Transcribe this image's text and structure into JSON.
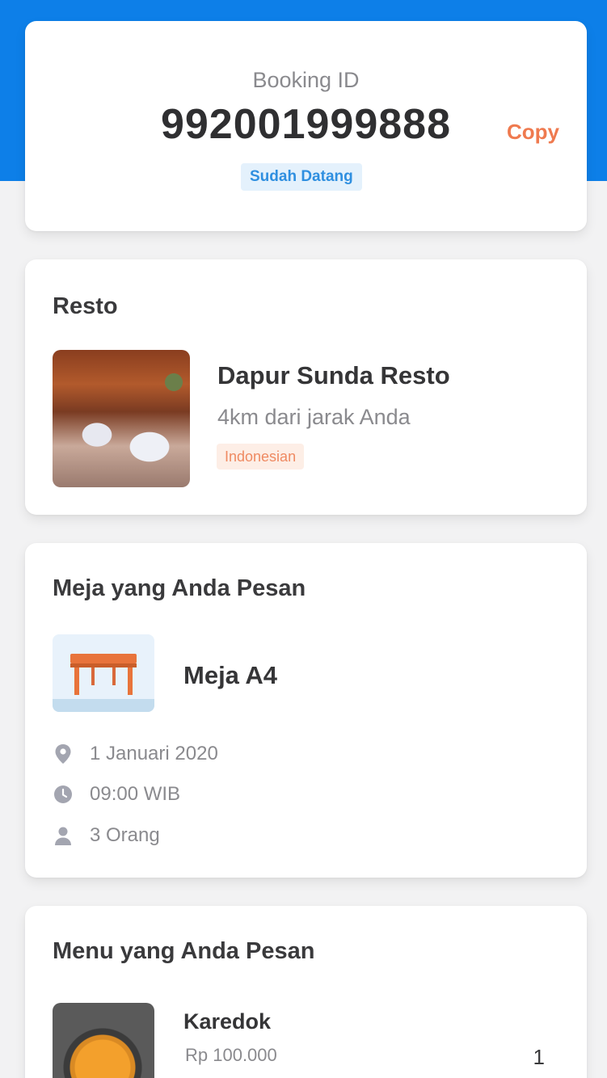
{
  "booking": {
    "label": "Booking ID",
    "id": "992001999888",
    "copy_label": "Copy",
    "status": "Sudah Datang"
  },
  "resto": {
    "section_title": "Resto",
    "name": "Dapur Sunda Resto",
    "distance": "4km dari jarak Anda",
    "cuisine": "Indonesian"
  },
  "table": {
    "section_title": "Meja yang Anda Pesan",
    "name": "Meja A4",
    "date": "1 Januari 2020",
    "time": "09:00 WIB",
    "guests": "3 Orang"
  },
  "menu": {
    "section_title": "Menu yang Anda Pesan",
    "items": [
      {
        "name": "Karedok",
        "price": "Rp 100.000",
        "qty": "1"
      }
    ]
  },
  "colors": {
    "header_blue": "#0d7fe8",
    "accent_orange": "#ef7a4f",
    "status_blue": "#2f8fe0"
  },
  "icons": [
    "location-pin-icon",
    "clock-icon",
    "person-icon",
    "table-icon"
  ]
}
